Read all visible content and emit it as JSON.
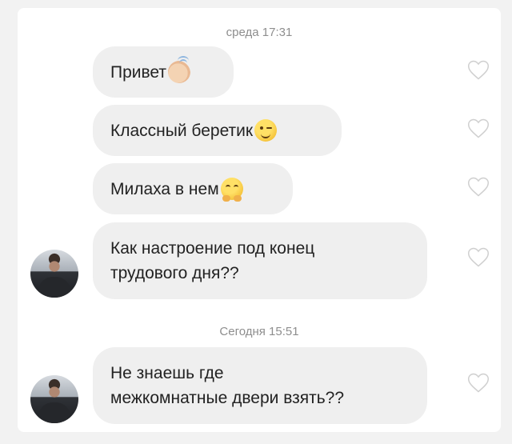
{
  "timestamps": [
    "среда 17:31",
    "Сегодня 15:51"
  ],
  "messages": [
    {
      "text": "Привет",
      "emoji": "waving-hand-icon"
    },
    {
      "text": "Классный беретик",
      "emoji": "winking-face-icon"
    },
    {
      "text": "Милаха в нем",
      "emoji": "hugging-face-icon"
    },
    {
      "text": "Как настроение под конец\nтрудового дня??"
    },
    {
      "text": "Не знаешь где\nмежкомнатные двери взять??"
    }
  ],
  "icons": {
    "like": "heart-outline-icon",
    "avatar": "user-avatar"
  },
  "colors": {
    "bubble": "#efefef",
    "timestamp": "#8e8e8e",
    "heart": "#cfcfcf"
  }
}
